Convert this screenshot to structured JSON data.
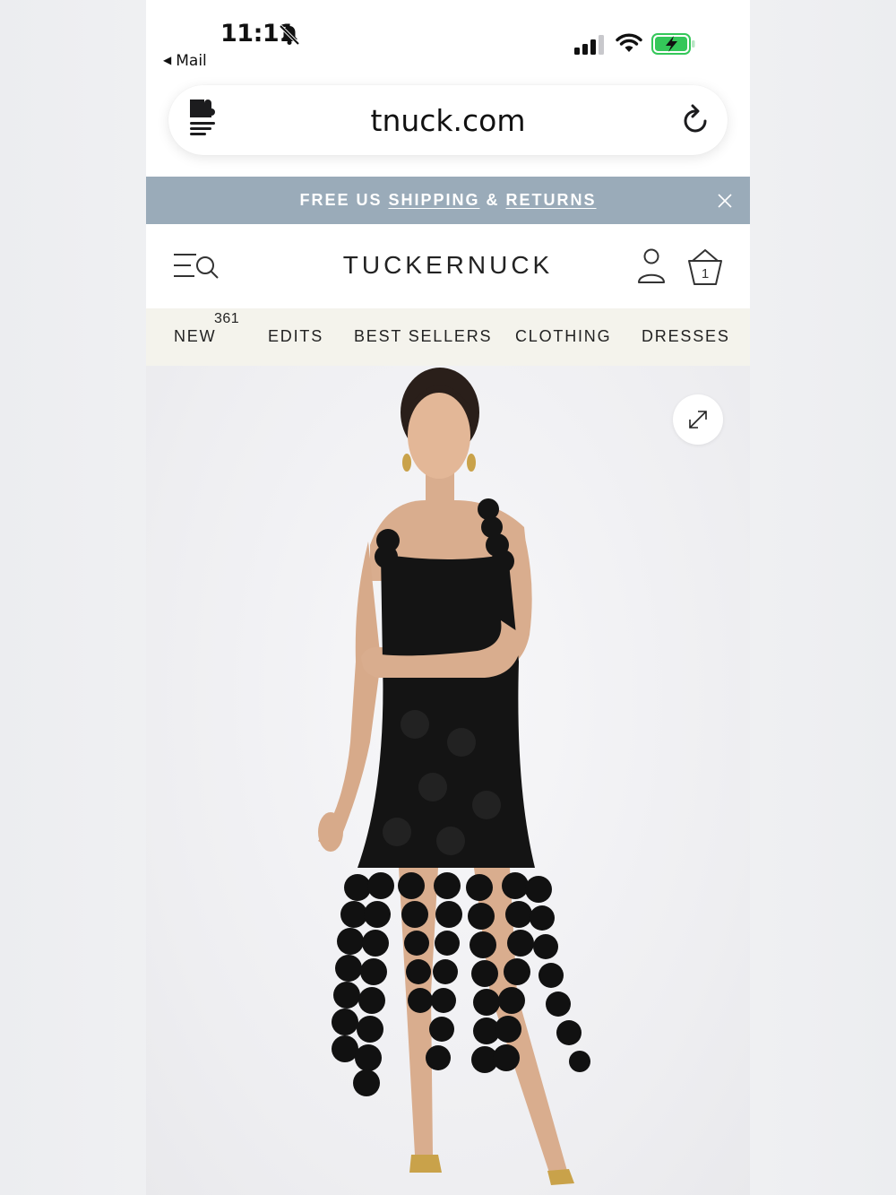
{
  "status_bar": {
    "time": "11:11",
    "back_app": "Mail",
    "icons": [
      "bell-slash-icon",
      "cellular-signal-icon",
      "wifi-icon",
      "battery-charging-icon"
    ],
    "battery_color": "#34c759"
  },
  "browser": {
    "url": "tnuck.com",
    "icons": [
      "extension-icon",
      "reload-icon"
    ]
  },
  "promo_banner": {
    "text_prefix": "FREE US ",
    "link_shipping": "SHIPPING",
    "separator": " & ",
    "link_returns": "RETURNS",
    "background": "#9aabb9"
  },
  "header": {
    "logo": "TUCKERNUCK",
    "cart_count": "1",
    "icons": [
      "menu-search-icon",
      "account-icon",
      "shopping-bag-icon"
    ]
  },
  "category_nav": {
    "items": [
      {
        "label": "NEW",
        "count": "361"
      },
      {
        "label": "EDITS"
      },
      {
        "label": "BEST SELLERS"
      },
      {
        "label": "CLOTHING"
      },
      {
        "label": "DRESSES"
      }
    ],
    "background": "#f4f3ec"
  },
  "product": {
    "image_alt": "Model wearing black circle-appliqué midi dress with fringed disc hem",
    "expand_icon": "expand-icon"
  }
}
